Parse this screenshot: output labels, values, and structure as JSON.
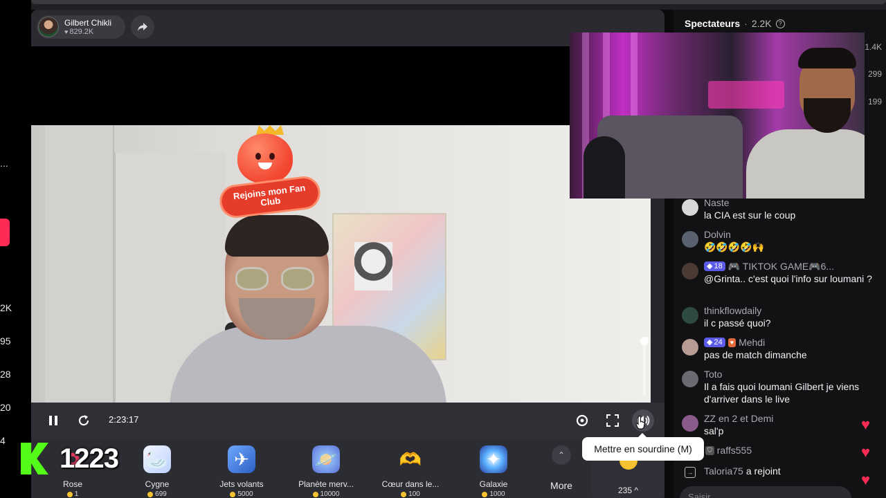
{
  "left_sidebar": {
    "ellipsis": "...",
    "counts": [
      "2K",
      "95",
      "28",
      "20",
      "4"
    ]
  },
  "host": {
    "name": "Gilbert Chikli",
    "likes": "829.2K"
  },
  "overlay": {
    "fan_club": "Rejoins mon Fan Club",
    "viewer_counter": "1223"
  },
  "controls": {
    "time": "2:23:17",
    "tooltip": "Mettre en sourdine (M)"
  },
  "gifts": [
    {
      "name": "Rose",
      "price": "1",
      "icon": "rose-icon"
    },
    {
      "name": "Cygne",
      "price": "699",
      "icon": "swan-icon"
    },
    {
      "name": "Jets volants",
      "price": "5000",
      "icon": "jets-icon"
    },
    {
      "name": "Planète merv...",
      "price": "10000",
      "icon": "planet-icon"
    },
    {
      "name": "Cœur dans le...",
      "price": "100",
      "icon": "heart-hands-icon"
    },
    {
      "name": "Galaxie",
      "price": "1000",
      "icon": "galaxy-icon"
    }
  ],
  "gift_more": "More",
  "balance": "235 ^",
  "spectators": {
    "title": "Spectateurs",
    "count": "2.2K",
    "ranks": [
      "1.4K",
      "299",
      "199"
    ]
  },
  "chat": [
    {
      "user": "Naste",
      "text": "la CIA est sur le coup"
    },
    {
      "user": "Dolvin",
      "text": "🤣🤣🤣🤣🙌"
    },
    {
      "user": "🎮 TIKTOK GAME🎮6...",
      "badge": "18",
      "text": "@Grinta.. c'est quoi l'info sur loumani ?"
    },
    {
      "user": "thinkflowdaily",
      "text": "il c passé quoi?"
    },
    {
      "user": "Mehdi",
      "badge": "24",
      "text": "pas de match dimanche"
    },
    {
      "user": "Toto",
      "text": "Il a fais quoi loumani Gilbert je viens d'arriver dans le live"
    },
    {
      "user": "ZZ en 2 et Demi",
      "text": "sal'p"
    },
    {
      "user": "raffs555",
      "text": ""
    },
    {
      "user": "Taloria75",
      "text": "a rejoint"
    }
  ],
  "chat_input_placeholder": "Saisir..."
}
